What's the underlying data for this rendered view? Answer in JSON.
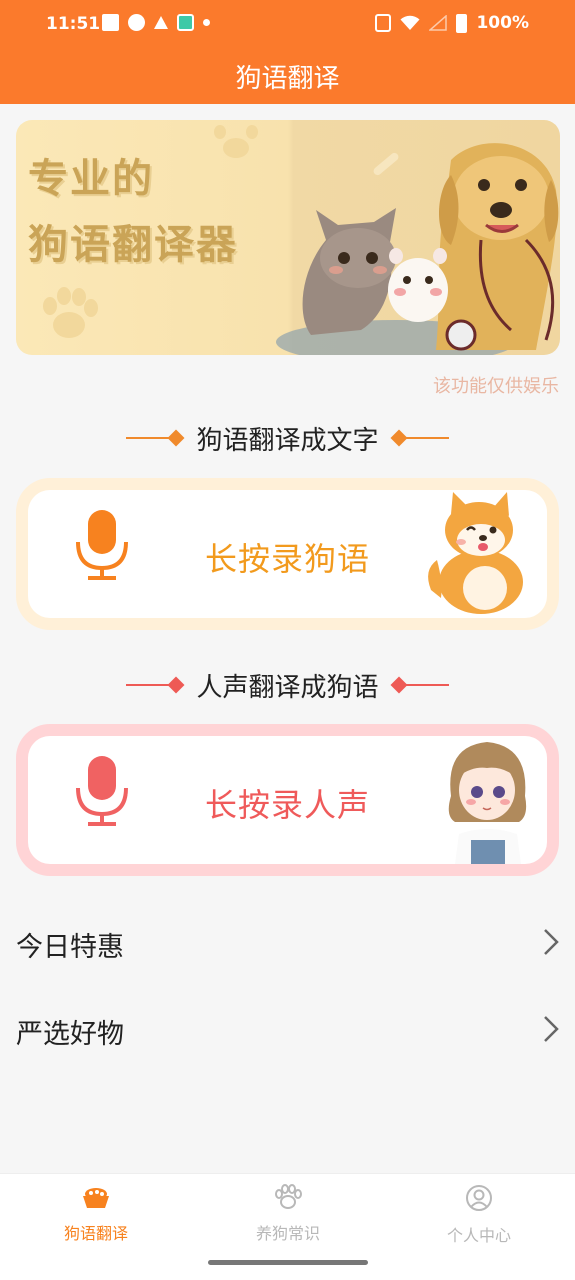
{
  "status_bar": {
    "time": "11:51",
    "battery": "100%",
    "icons": [
      "mail-icon",
      "check-circle-icon",
      "warning-icon",
      "app-icon",
      "dot-icon",
      "vibrate-icon",
      "wifi-icon",
      "signal-icon",
      "battery-icon"
    ]
  },
  "header": {
    "title": "狗语翻译"
  },
  "banner": {
    "line1": "专业的",
    "line2": "狗语翻译器"
  },
  "disclaimer": "该功能仅供娱乐",
  "dog_section": {
    "heading": "狗语翻译成文字",
    "button_label": "长按录狗语"
  },
  "human_section": {
    "heading": "人声翻译成狗语",
    "button_label": "长按录人声"
  },
  "list": {
    "items": [
      {
        "label": "今日特惠"
      },
      {
        "label": "严选好物"
      }
    ]
  },
  "bottom_nav": {
    "items": [
      {
        "label": "狗语翻译",
        "icon": "dog-bowl-icon",
        "active": true
      },
      {
        "label": "养狗常识",
        "icon": "paw-icon",
        "active": false
      },
      {
        "label": "个人中心",
        "icon": "person-icon",
        "active": false
      }
    ]
  },
  "colors": {
    "accent": "#fb7a2c",
    "dog_text": "#f29a1d",
    "human_text": "#ef5a5a",
    "dog_card_border": "#fff0d8",
    "human_card_border": "#ffd4d6",
    "inactive_nav": "#b8b8b8"
  }
}
